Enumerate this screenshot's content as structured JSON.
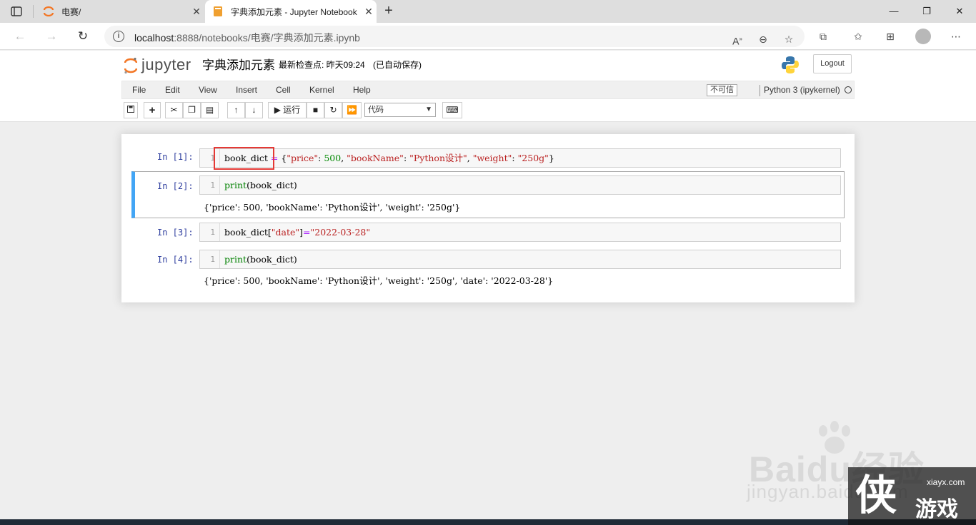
{
  "browser": {
    "tabs": [
      {
        "title": "电赛/",
        "active": false
      },
      {
        "title": "字典添加元素 - Jupyter Notebook",
        "active": true
      }
    ],
    "address": {
      "host": "localhost",
      "path": ":8888/notebooks/电赛/字典添加元素.ipynb"
    }
  },
  "jupyter": {
    "logo_text": "jupyter",
    "notebook_name": "字典添加元素",
    "checkpoint": "最新检查点: 昨天09:24",
    "autosave": "(已自动保存)",
    "logout_label": "Logout",
    "menu": [
      "File",
      "Edit",
      "View",
      "Insert",
      "Cell",
      "Kernel",
      "Help"
    ],
    "trust_label": "不可信",
    "kernel_name": "Python 3 (ipykernel)",
    "run_label": "运行",
    "cell_type": "代码"
  },
  "cells": [
    {
      "prompt": "In  [1]:",
      "line": "1",
      "output": null
    },
    {
      "prompt": "In  [2]:",
      "line": "1",
      "output": "{'price': 500, 'bookName': 'Python设计', 'weight': '250g'}"
    },
    {
      "prompt": "In  [3]:",
      "line": "1",
      "output": null
    },
    {
      "prompt": "In  [4]:",
      "line": "1",
      "output": "{'price': 500, 'bookName': 'Python设计', 'weight': '250g', 'date': '2022-03-28'}"
    }
  ],
  "code": {
    "c1": {
      "var": "book_dict",
      "eq": " = ",
      "open": "{",
      "k1": "\"price\"",
      "colon1": ": ",
      "v1": "500",
      "sep1": ", ",
      "k2": "\"bookName\"",
      "colon2": ": ",
      "v2": "\"Python设计\"",
      "sep2": ", ",
      "k3": "\"weight\"",
      "colon3": ": ",
      "v3": "\"250g\"",
      "close": "}"
    },
    "c2": {
      "fn": "print",
      "args": "(book_dict)"
    },
    "c3": {
      "var": "book_dict[",
      "key": "\"date\"",
      "mid": "]",
      "eq": "=",
      "val": "\"2022-03-28\""
    },
    "c4": {
      "fn": "print",
      "args": "(book_dict)"
    }
  },
  "watermark": {
    "main": "Baidu经验",
    "sub": "jingyan.baidu.com",
    "site": "xiayx.com",
    "corner_big": "侠",
    "corner_name": "游戏"
  },
  "colors": {
    "selected_cell_border": "#42a5f5",
    "highlight_box": "#e53935",
    "prompt_in": "#303f9f"
  }
}
